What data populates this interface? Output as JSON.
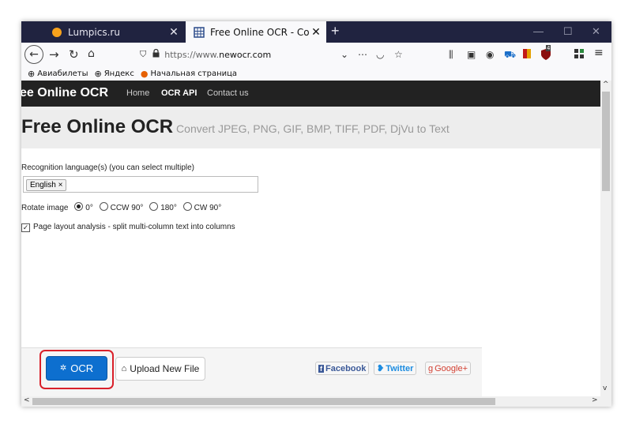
{
  "browser": {
    "tabs": [
      {
        "label": "Lumpics.ru",
        "close": "✕",
        "active": false
      },
      {
        "label": "Free Online OCR - Convert JPEG",
        "close": "✕",
        "active": true
      }
    ],
    "new_tab": "+",
    "window_controls": {
      "minimize": "—",
      "maximize": "☐",
      "close": "✕"
    },
    "url": {
      "prefix": "https://www.",
      "domain": "newocr.com"
    },
    "bookmarks": [
      "Авиабилеты",
      "Яндекс",
      "Начальная страница"
    ],
    "extension_badge": "4"
  },
  "site": {
    "logo": "ee Online OCR",
    "nav": [
      "Home",
      "OCR API",
      "Contact us"
    ],
    "title": "Free Online OCR",
    "subtitle": "Convert JPEG, PNG, GIF, BMP, TIFF, PDF, DjVu to Text",
    "lang_label": "Recognition language(s) (you can select multiple)",
    "lang_tag": "English ×",
    "rotate_label": "Rotate image",
    "rotate_options": [
      "0°",
      "CCW 90°",
      "180°",
      "CW 90°"
    ],
    "rotate_selected": "0°",
    "layout_label": "Page layout analysis - split multi-column text into columns",
    "layout_checked": true,
    "ocr_button": "OCR",
    "upload_button": "Upload New File",
    "social": [
      "Facebook",
      "Twitter",
      "Google+"
    ]
  },
  "colors": {
    "ocr_button": "#0d6fcf",
    "highlight": "#d9202a",
    "tabbar": "#202340"
  }
}
